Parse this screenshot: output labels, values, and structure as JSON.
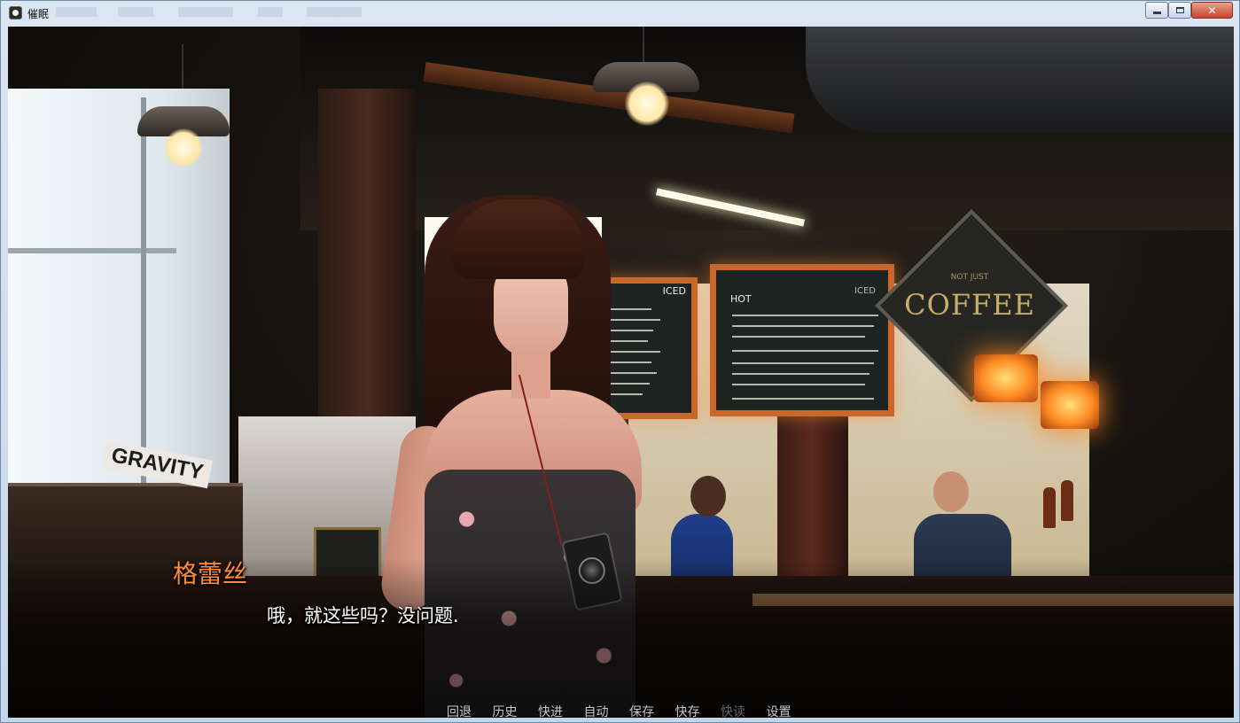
{
  "window": {
    "title": "催眠",
    "controls": {
      "minimize": "minimize",
      "maximize": "maximize",
      "close": "✕"
    }
  },
  "scene": {
    "menu_board_left": {
      "heading": "ICED"
    },
    "menu_board_right": {
      "heading_left": "HOT",
      "heading_right": "ICED"
    },
    "coffee_sign": {
      "small": "NOT JUST",
      "main": "COFFEE"
    },
    "crate_label": "GRAVITY"
  },
  "dialogue": {
    "speaker": "格蕾丝",
    "text": "哦，就这些吗？没问题."
  },
  "quick_menu": {
    "items": [
      {
        "label": "回退",
        "enabled": true
      },
      {
        "label": "历史",
        "enabled": true
      },
      {
        "label": "快进",
        "enabled": true
      },
      {
        "label": "自动",
        "enabled": true
      },
      {
        "label": "保存",
        "enabled": true
      },
      {
        "label": "快存",
        "enabled": true
      },
      {
        "label": "快读",
        "enabled": false
      },
      {
        "label": "设置",
        "enabled": true
      }
    ]
  },
  "colors": {
    "speaker": "#ff8a3d",
    "dialogue": "#ffffff",
    "menu_frame": "#c9682a"
  }
}
